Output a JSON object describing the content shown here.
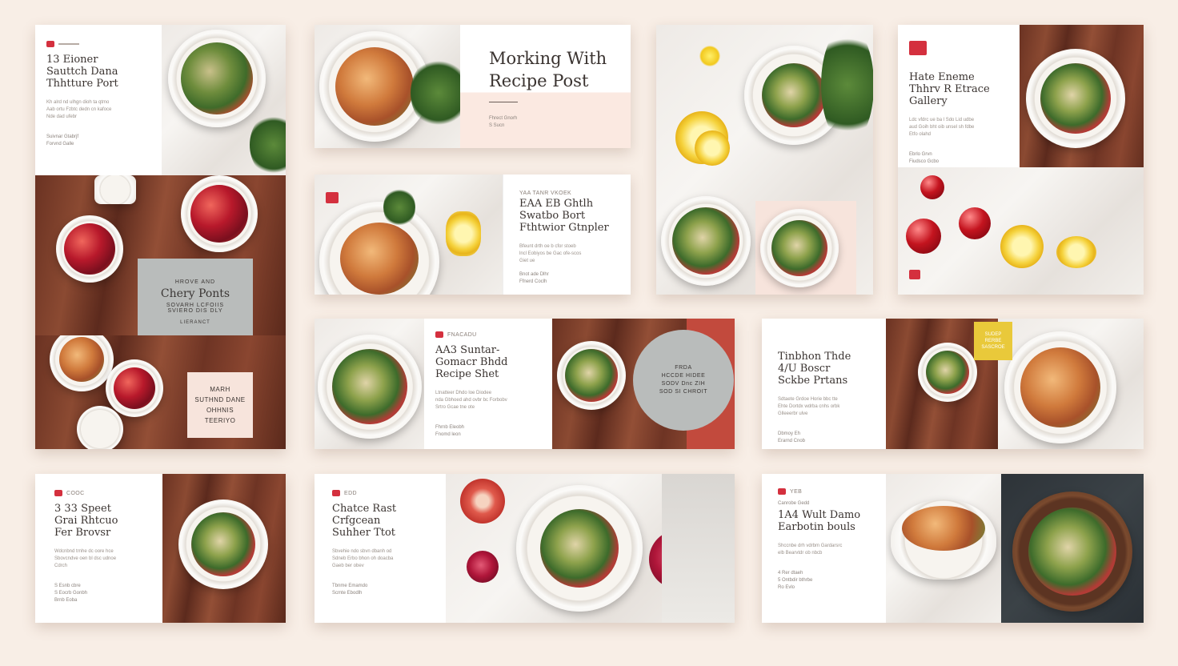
{
  "c1": {
    "kicker": "",
    "title": [
      "13 Eioner",
      "Sauttch Dana",
      "Thhtture Port"
    ],
    "body": [
      "Kh alrd nd ulhgn dioh ta qtmo",
      "Aab ortu Fzbtc dedn cn kafoce",
      "Nde dad ufebr"
    ],
    "footer": [
      "Suivnar Gtabrjf",
      "Forvnd Galle"
    ],
    "grey_overlay": [
      "HROVE AND",
      "Chery Ponts",
      "SOVARH LCFOIIS",
      "SVIERO DIS DLY",
      "LIERANCT"
    ],
    "pink_overlay": [
      "MARH",
      "SUTHND DANE",
      "OHHNIS",
      "TEERIYO"
    ]
  },
  "c2": {
    "title": [
      "Morking With",
      "Recipe Post"
    ],
    "footer": [
      "Fhrect Gnorh",
      "S Sucn"
    ]
  },
  "c3": {
    "kicker": "Yaa tanr  VKOEK",
    "title": [
      "EAA EB Ghtlh",
      "Swatbo Bort",
      "Fthtwior Gtnpler"
    ],
    "body": [
      "Bfeunt drth oe b cfor stoeb",
      "lncl Eobiyos be Gac ofe-scos",
      "Giet ue"
    ],
    "footer": [
      "Bnot ade Dlhr",
      "Ffnerd Coclh"
    ]
  },
  "c5": {
    "title": [
      "Hate Eneme",
      "Thhrv R Etrace",
      "Gallery"
    ],
    "body": [
      "Ldc vfdrc ue ba l Sdo Lid udbe",
      "aud Goih bht oib unsel sh fdbe",
      "Etfo olahd"
    ],
    "footer": [
      "Ebrlo Grvn",
      "Fiudsco Gcbo"
    ]
  },
  "c6": {
    "kicker": "Fnacadu",
    "title": [
      "AA3 Suntar-",
      "Gomacr Bhdd",
      "Recipe Shet"
    ],
    "body": [
      "Ltnatteer Dhdo loe Diodee",
      "nda Gbhoed ahd ovbr bc  Forbobv",
      "Srtro Gcae tne ote"
    ],
    "footer": [
      "Fhrnb Eleobh",
      "Fnomd leon"
    ],
    "circle": [
      "FRDA",
      "HCCDE HIDEE",
      "SODV Dnc ZIH",
      "SOD SI CHROIT"
    ]
  },
  "c7": {
    "title": [
      "Tinbhon Thde",
      "4/U Boscr",
      "Sckbe Prtans"
    ],
    "body": [
      "Sdtaete Grdoe Horie bbc tte",
      "Ehte Dortdx wdrba cnhs orbk",
      "Glleeerbr ulve"
    ],
    "footer": [
      "Dbmoy Eh",
      "Erarnd Cnob"
    ],
    "badge": [
      "SUDEP",
      "RERBE",
      "SASCROE"
    ]
  },
  "c8": {
    "kicker": "Cooc",
    "title": [
      "3 33 Speet",
      "Grai Rhtcuo",
      "Fer Brovsr"
    ],
    "body": [
      "Wdcnbnd  trnhe dc oore hce",
      "Sbovcndve oen bl dsc udnoe",
      "Cdrch"
    ],
    "footer": [
      "S Esnb cbre",
      "S Eocrb Gonbh",
      "Brnb Eoba"
    ]
  },
  "c9": {
    "kicker": "Edd",
    "title": [
      "Chatce Rast",
      "Crfgcean",
      "Suhher Ttot"
    ],
    "body": [
      "Sbvehie ndo sbvn dbanh od",
      "Sdneb Erbo bhon oh doacba",
      "Gaeb ber obev"
    ],
    "footer": [
      "Tbnme Emamdo",
      "Scmte Ebodlh"
    ]
  },
  "c10": {
    "kicker": "Yeb",
    "subkicker": "Canrobe Gedd",
    "title": [
      "1A4 Wult Damo",
      "Earbotin bouls"
    ],
    "body": [
      "Shccnbe drh vdrbm Gardarsrc",
      "elb Bearvtdr ob nbcb"
    ],
    "footer": [
      "4 Rer dtaeh",
      "5 Ontbdir bthrbe",
      "Ro Evlo"
    ]
  },
  "colors": {
    "background": "#f8eee6",
    "accent_red": "#d4303e",
    "overlay_grey": "#b9bcbb",
    "badge_yellow": "#e9c93a",
    "pink": "#f7e4dc"
  }
}
